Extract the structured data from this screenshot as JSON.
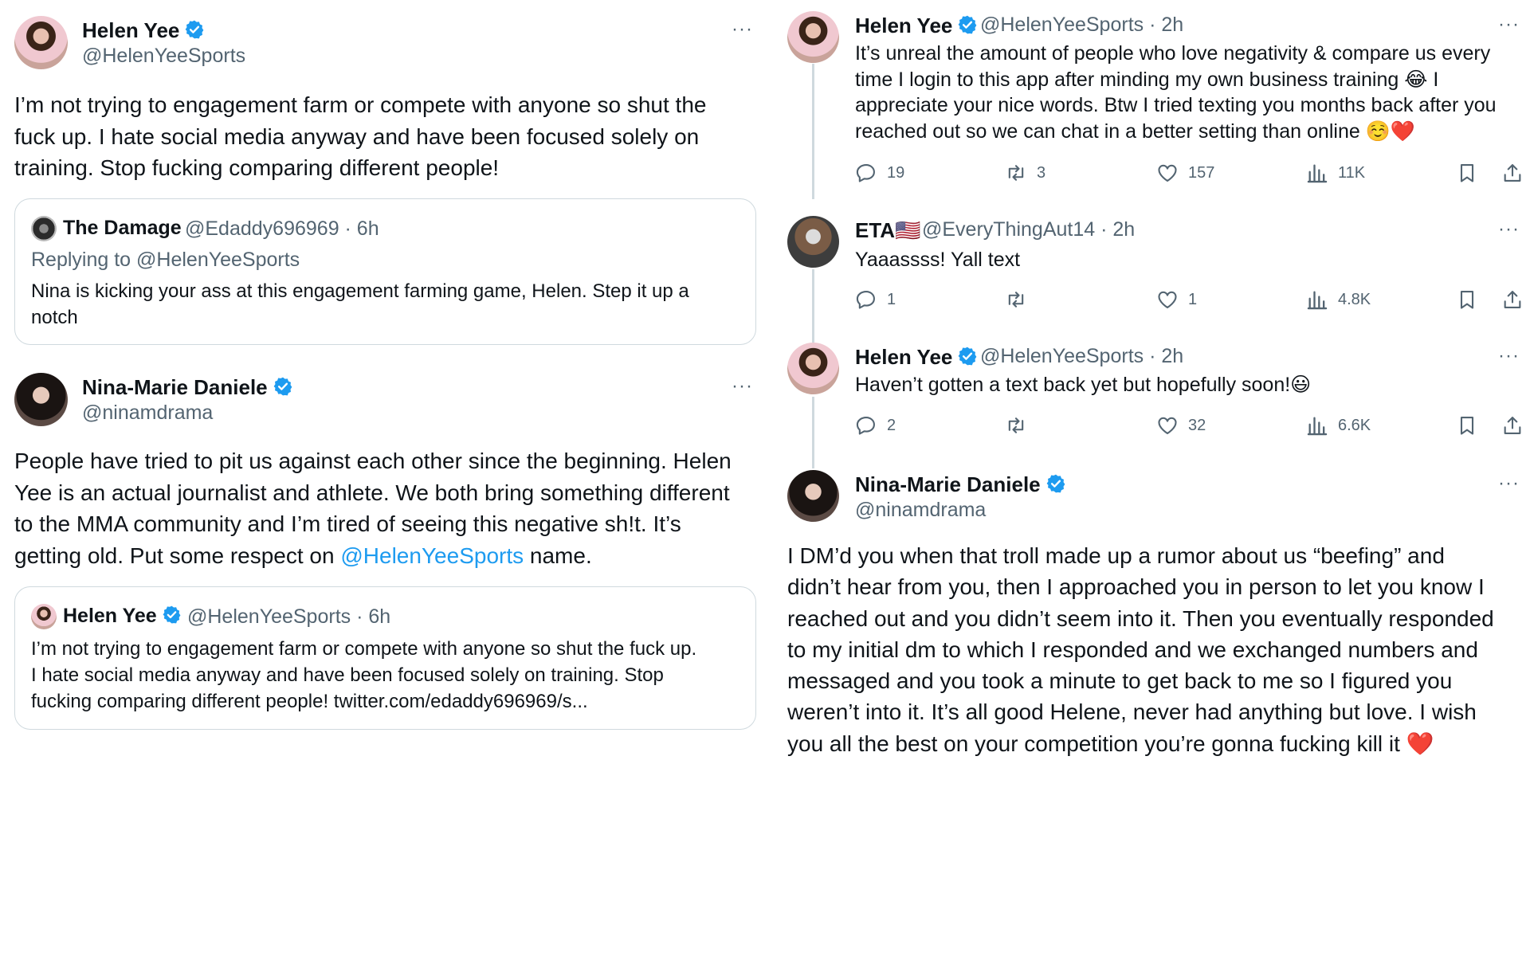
{
  "left": {
    "tweet1": {
      "name": "Helen Yee",
      "handle": "@HelenYeeSports",
      "more": "···",
      "text": "I’m not trying to engagement farm or compete with anyone so shut the\nfuck up. I hate social media anyway and have been focused solely on\ntraining. Stop fucking comparing different people!",
      "quote": {
        "name": "The Damage",
        "handle_time": "@Edaddy696969 · 6h",
        "replying": "Replying to @HelenYeeSports",
        "text": "Nina is kicking your ass at this engagement farming game, Helen. Step it up a\nnotch"
      }
    },
    "tweet2": {
      "name": "Nina-Marie Daniele",
      "handle": "@ninamdrama",
      "more": "···",
      "text_before": "People have tried to pit us against each other since the beginning. Helen\nYee is an actual journalist and athlete. We both bring something different\nto the MMA community and I’m tired of seeing this negative sh!t. It’s\ngetting old. Put some respect on ",
      "mention": "@HelenYeeSports",
      "text_after": " name.",
      "quote": {
        "name": "Helen Yee",
        "handle_time": "@HelenYeeSports · 6h",
        "text": "I’m not trying to engagement farm or compete with anyone so shut the fuck up.\nI hate social media anyway and have been focused solely on training. Stop\nfucking comparing different people! twitter.com/edaddy696969/s..."
      }
    }
  },
  "right": {
    "reply1": {
      "name": "Helen Yee",
      "handle_time": "@HelenYeeSports · 2h",
      "more": "···",
      "text": "It’s unreal the amount of people who love negativity & compare us every\ntime I login to this app after minding my own business training 😂 I\nappreciate your nice words. Btw I tried texting you months back after you\nreached out so we can chat in a better setting than online ☺️❤️",
      "replies": "19",
      "retweets": "3",
      "likes": "157",
      "views": "11K"
    },
    "reply2": {
      "name": "ETA🇺🇸",
      "handle_time": "@EveryThingAut14 · 2h",
      "more": "···",
      "text": "Yaaassss! Yall text",
      "replies": "1",
      "retweets": "",
      "likes": "1",
      "views": "4.8K"
    },
    "reply3": {
      "name": "Helen Yee",
      "handle_time": "@HelenYeeSports · 2h",
      "more": "···",
      "text": "Haven’t gotten a text back yet but hopefully soon!😃",
      "replies": "2",
      "retweets": "",
      "likes": "32",
      "views": "6.6K"
    },
    "reply4": {
      "name": "Nina-Marie Daniele",
      "handle": "@ninamdrama",
      "more": "···",
      "text": "I DM’d you when that troll made up a rumor about us “beefing” and\ndidn’t hear from you, then I approached you in person to let you know I\nreached out and you didn’t seem into it. Then you eventually responded\nto my initial dm to which I responded and we exchanged numbers and\nmessaged and you took a minute to get back to me so I figured you\nweren’t into it. It’s all good Helene, never had anything but love. I wish\nyou all the best on your competition you’re gonna fucking kill it ❤️"
    }
  },
  "colors": {
    "verified": "#1d9bf0",
    "mention": "#1d9bf0",
    "muted": "#536471",
    "border": "#cfd9de"
  },
  "icons": [
    "verified-badge-icon",
    "reply-icon",
    "retweet-icon",
    "like-icon",
    "views-icon",
    "bookmark-icon",
    "share-icon",
    "more-icon"
  ]
}
